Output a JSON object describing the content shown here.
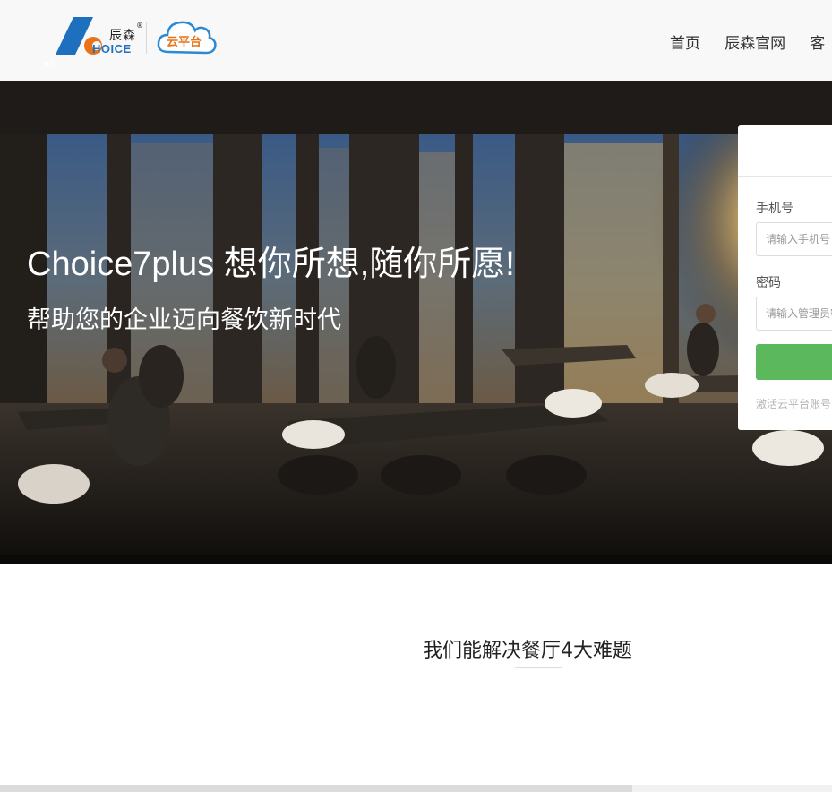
{
  "header": {
    "logo": {
      "cn_text": "辰森",
      "registered_mark": "®",
      "en_text": "HOICE",
      "cloud_text": "云平台"
    },
    "corner_badge": "NR",
    "nav": [
      "首页",
      "辰森官网",
      "客"
    ]
  },
  "hero": {
    "title": "Choice7plus 想你所想,随你所愿!",
    "subtitle": "帮助您的企业迈向餐饮新时代"
  },
  "login": {
    "phone_label": "手机号",
    "phone_placeholder": "请输入手机号",
    "password_label": "密码",
    "password_placeholder": "请输入管理员密码",
    "activate_text": "激活云平台账号"
  },
  "section": {
    "title": "我们能解决餐厅4大难题"
  },
  "colors": {
    "brand_blue": "#1f6fbf",
    "brand_orange": "#e8731a",
    "login_button": "#5cb85c"
  }
}
